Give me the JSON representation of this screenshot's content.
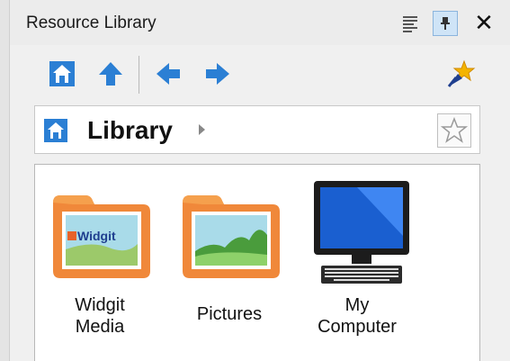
{
  "panel": {
    "title": "Resource Library",
    "buttons": {
      "menu_icon": "list-lines-icon",
      "pin_icon": "pin-icon",
      "close_label": "✕"
    }
  },
  "toolbar": {
    "home_icon": "home-icon",
    "up_icon": "arrow-up-icon",
    "back_icon": "arrow-left-icon",
    "forward_icon": "arrow-right-icon",
    "favorites_icon": "pin-star-icon"
  },
  "breadcrumb": {
    "label": "Library",
    "favorite_icon": "star-outline-icon"
  },
  "items": [
    {
      "line1": "Widgit",
      "line2": "Media",
      "icon": "folder-widgit-icon"
    },
    {
      "line1": "Pictures",
      "line2": "",
      "icon": "folder-pictures-icon"
    },
    {
      "line1": "My",
      "line2": "Computer",
      "icon": "computer-icon"
    }
  ],
  "colors": {
    "accent_blue": "#2b7fd4",
    "folder_orange": "#f0883a",
    "folder_tab": "#f5a04d"
  }
}
